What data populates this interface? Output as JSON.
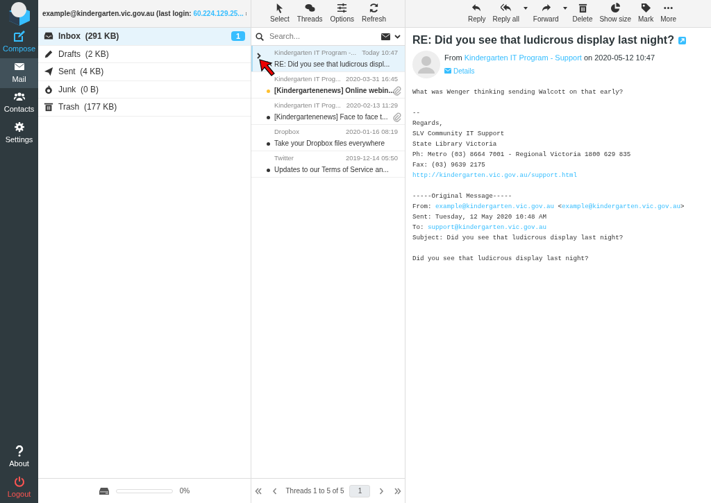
{
  "nav": [
    {
      "label": "Compose",
      "kind": "compose",
      "selected": false
    },
    {
      "label": "Mail",
      "kind": "page",
      "selected": true
    },
    {
      "label": "Contacts",
      "kind": "page",
      "selected": false
    },
    {
      "label": "Settings",
      "kind": "page",
      "selected": false
    }
  ],
  "nav_bottom": [
    {
      "label": "About",
      "kind": "page"
    },
    {
      "label": "Logout",
      "kind": "logout"
    }
  ],
  "account": {
    "email": "example@kindergarten.vic.gov.au (last login: ",
    "last_login": "60.224.129.25..."
  },
  "folders": [
    {
      "name": "Inbox",
      "size": "(291 KB)",
      "selected": true,
      "unread": "1"
    },
    {
      "name": "Drafts",
      "size": "(2 KB)",
      "selected": false
    },
    {
      "name": "Sent",
      "size": "(4 KB)",
      "selected": false
    },
    {
      "name": "Junk",
      "size": "(0 B)",
      "selected": false
    },
    {
      "name": "Trash",
      "size": "(177 KB)",
      "selected": false
    }
  ],
  "quota": {
    "level": 0,
    "reading": "0%"
  },
  "list_toolbar": [
    "Select",
    "Threads",
    "Options",
    "Refresh"
  ],
  "search": {
    "placeholder": "Search..."
  },
  "messages": [
    {
      "from": "Kindergarten IT Program -...",
      "date": "Today 10:47",
      "subject": "RE: Did you see that ludicrous displ...",
      "selected": true,
      "unread": false,
      "replied": true,
      "attachment": false
    },
    {
      "from": "Kindergarten IT Prog...",
      "date": "2020-03-31 16:45",
      "subject": "[Kindergartenenews] Online webin...",
      "selected": false,
      "unread": true,
      "replied": false,
      "attachment": true
    },
    {
      "from": "Kindergarten IT Prog...",
      "date": "2020-02-13 11:29",
      "subject": "[Kindergartenenews] Face to face t...",
      "selected": false,
      "unread": false,
      "replied": false,
      "attachment": true
    },
    {
      "from": "Dropbox",
      "date": "2020-01-16 08:19",
      "subject": "Take your Dropbox files everywhere",
      "selected": false,
      "unread": false,
      "replied": false,
      "attachment": false
    },
    {
      "from": "Twitter",
      "date": "2019-12-14 05:50",
      "subject": "Updates to our Terms of Service an...",
      "selected": false,
      "unread": false,
      "replied": false,
      "attachment": false
    }
  ],
  "pager": {
    "text": "Threads 1 to 5 of 5",
    "page": "1"
  },
  "message_toolbar": [
    {
      "label": "Reply",
      "dropdown": false
    },
    {
      "label": "Reply all",
      "dropdown": true
    },
    {
      "label": "Forward",
      "dropdown": true
    },
    {
      "label": "Delete",
      "dropdown": false
    },
    {
      "label": "Show size",
      "dropdown": false
    },
    {
      "label": "Mark",
      "dropdown": false
    },
    {
      "label": "More",
      "dropdown": false
    }
  ],
  "message": {
    "subject": "RE: Did you see that ludicrous display last night?",
    "from_prefix": "From",
    "sender": "Kindergarten IT Program - Support",
    "date": "on 2020-05-12 10:47",
    "details": "Details",
    "body": [
      [
        [
          {
            "kind": "text",
            "text": "What was Wenger thinking sending Walcott on that early?"
          }
        ]
      ],
      [
        [
          {
            "kind": "text",
            "text": "--"
          }
        ],
        [
          {
            "kind": "text",
            "text": "Regards,"
          }
        ],
        [
          {
            "kind": "text",
            "text": "SLV Community IT Support"
          }
        ],
        [
          {
            "kind": "text",
            "text": "State Library Victoria"
          }
        ],
        [
          {
            "kind": "text",
            "text": "Ph: Metro (03) 8664 7001 - Regional Victoria 1800 629 835"
          }
        ],
        [
          {
            "kind": "text",
            "text": "Fax: (03) 9639 2175"
          }
        ],
        [
          {
            "kind": "link",
            "text": "http://kindergarten.vic.gov.au/support.html"
          }
        ]
      ],
      [
        [
          {
            "kind": "text",
            "text": "-----Original Message-----"
          }
        ],
        [
          {
            "kind": "text",
            "text": "From: "
          },
          {
            "kind": "link",
            "text": "example@kindergarten.vic.gov.au"
          },
          {
            "kind": "text",
            "text": " <"
          },
          {
            "kind": "link",
            "text": "example@kindergarten.vic.gov.au"
          },
          {
            "kind": "text",
            "text": ">"
          }
        ],
        [
          {
            "kind": "text",
            "text": "Sent: Tuesday, 12 May 2020 10:48 AM"
          }
        ],
        [
          {
            "kind": "text",
            "text": "To: "
          },
          {
            "kind": "link",
            "text": "support@kindergarten.vic.gov.au"
          }
        ],
        [
          {
            "kind": "text",
            "text": "Subject: Did you see that ludicrous display last night?"
          }
        ]
      ],
      [
        [
          {
            "kind": "text",
            "text": "Did you see that ludicrous display last night?"
          }
        ]
      ]
    ]
  }
}
